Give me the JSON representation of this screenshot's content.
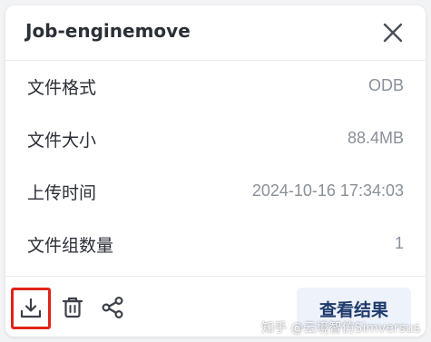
{
  "dialog": {
    "title": "Job-enginemove",
    "close_icon": "close-icon"
  },
  "details": [
    {
      "label": "文件格式",
      "value": "ODB"
    },
    {
      "label": "文件大小",
      "value": "88.4MB"
    },
    {
      "label": "上传时间",
      "value": "2024-10-16 17:34:03"
    },
    {
      "label": "文件组数量",
      "value": "1"
    }
  ],
  "footer": {
    "download_icon": "download-icon",
    "delete_icon": "trash-icon",
    "share_icon": "share-icon",
    "view_results_label": "查看结果"
  },
  "watermark": "知乎 @云境智仿Simversus",
  "colors": {
    "highlight_border": "#e0241b",
    "primary_button_bg": "#edf2fb",
    "primary_button_text": "#1f3a6b",
    "value_text": "#8a9099"
  }
}
